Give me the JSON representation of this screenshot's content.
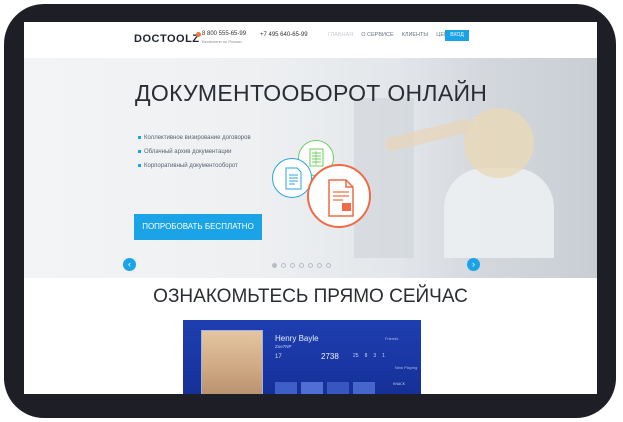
{
  "header": {
    "logo": "DOCTOOLZ",
    "phone1": "8 800 555-65-99",
    "phone1_sub": "Бесплатно по России",
    "phone2": "+7 495 640-65-99",
    "nav": [
      "ГЛАВНАЯ",
      "О СЕРВИСЕ",
      "КЛИЕНТЫ",
      "ЦЕНЫ"
    ],
    "login": "ВХОД"
  },
  "hero": {
    "title": "ДОКУМЕНТООБОРОТ ОНЛАЙН",
    "bullets": [
      "Коллективное визирование договоров",
      "Облачный архив документации",
      "Корпоративный документооборот"
    ],
    "cta": "ПОПРОБОВАТЬ БЕСПЛАТНО",
    "slides_total": 7,
    "slide_active": 1
  },
  "section": {
    "title": "ОЗНАКОМЬТЕСЬ ПРЯМО СЕЙЧАС"
  },
  "console": {
    "name": "Henry Bayle",
    "uid": "Zoe7NP",
    "level": "17",
    "score": "2738",
    "trophies": [
      "25",
      "8",
      "3",
      "1"
    ],
    "friends": "Friends",
    "news": "New Playing",
    "game": "KNACK"
  },
  "colors": {
    "accent": "#1ba3e8",
    "green": "#6ccf5f",
    "orange": "#ef6a45",
    "frame": "#1e1f26"
  }
}
